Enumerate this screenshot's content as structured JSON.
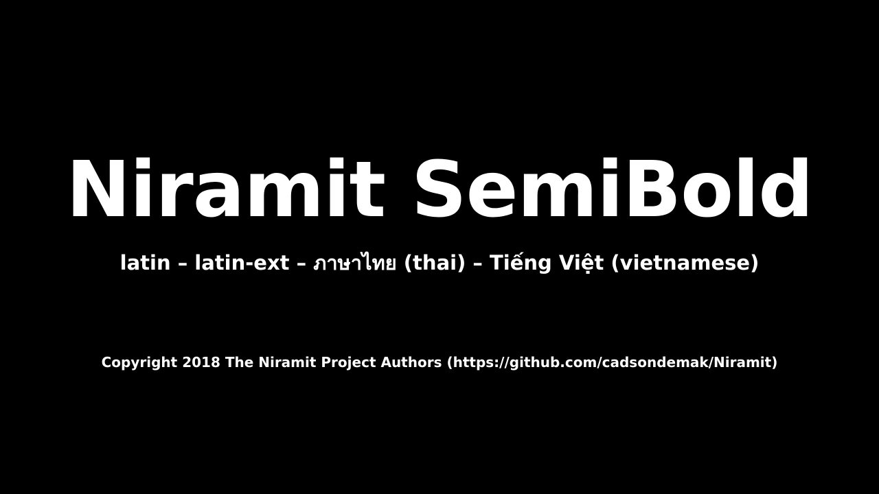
{
  "font_name": "Niramit SemiBold",
  "subsets_line": "latin – latin-ext – ภาษาไทย (thai) – Tiếng Việt (vietnamese)",
  "copyright": "Copyright 2018 The Niramit Project Authors (https://github.com/cadsondemak/Niramit)",
  "colors": {
    "background": "#000000",
    "text": "#ffffff"
  }
}
